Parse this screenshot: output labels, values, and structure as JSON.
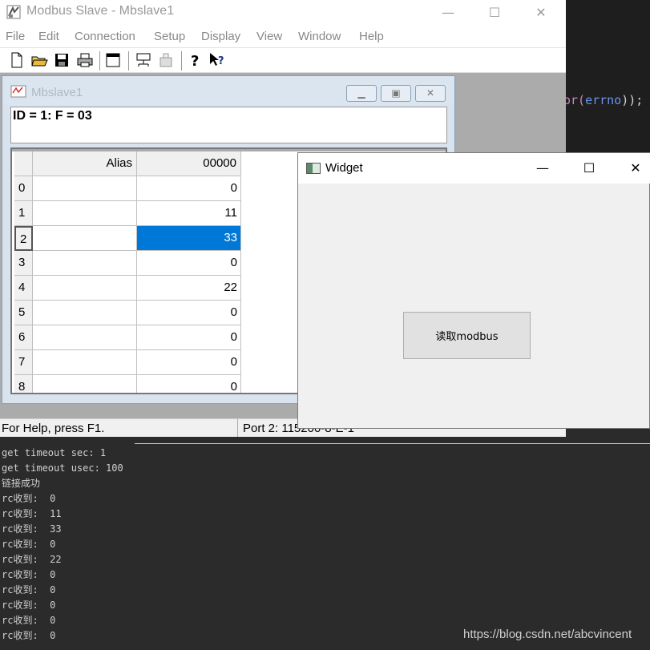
{
  "editor": {
    "code_prefix": "or(",
    "code_var": "errno",
    "code_suffix": "));"
  },
  "modbus": {
    "title": "Modbus Slave - Mbslave1",
    "window_controls": {
      "minimize": "—",
      "maximize": "☐",
      "close": "✕"
    },
    "menu": [
      "File",
      "Edit",
      "Connection",
      "Setup",
      "Display",
      "View",
      "Window",
      "Help"
    ],
    "toolbar_icons": [
      "new-file-icon",
      "open-folder-icon",
      "save-icon",
      "print-icon",
      "window-icon",
      "connect-icon",
      "disconnect-icon",
      "help-icon",
      "context-help-icon"
    ],
    "child": {
      "title": "Mbslave1",
      "id_line": "ID = 1: F = 03",
      "header_alias": "Alias",
      "header_col": "00000",
      "rows": [
        {
          "index": "0",
          "value": "0"
        },
        {
          "index": "1",
          "value": "11"
        },
        {
          "index": "2",
          "value": "33",
          "selected": true
        },
        {
          "index": "3",
          "value": "0"
        },
        {
          "index": "4",
          "value": "22"
        },
        {
          "index": "5",
          "value": "0"
        },
        {
          "index": "6",
          "value": "0"
        },
        {
          "index": "7",
          "value": "0"
        },
        {
          "index": "8",
          "value": "0"
        }
      ]
    },
    "status": {
      "help": "For Help, press F1.",
      "port": "Port 2: 115200-8-E-1"
    }
  },
  "widget": {
    "title": "Widget",
    "controls": {
      "minimize": "—",
      "maximize": "☐",
      "close": "✕"
    },
    "button_label": "读取modbus"
  },
  "console": {
    "lines": [
      "get timeout sec: 1",
      "get timeout usec: 100",
      "链接成功",
      "rc收到:  0",
      "rc收到:  11",
      "rc收到:  33",
      "rc收到:  0",
      "rc收到:  22",
      "rc收到:  0",
      "rc收到:  0",
      "rc收到:  0",
      "rc收到:  0",
      "rc收到:  0"
    ],
    "watermark": "https://blog.csdn.net/abcvincent"
  },
  "colors": {
    "selection": "#0078d7",
    "console_bg": "#2b2b2b",
    "mdi_bg": "#ababab"
  }
}
